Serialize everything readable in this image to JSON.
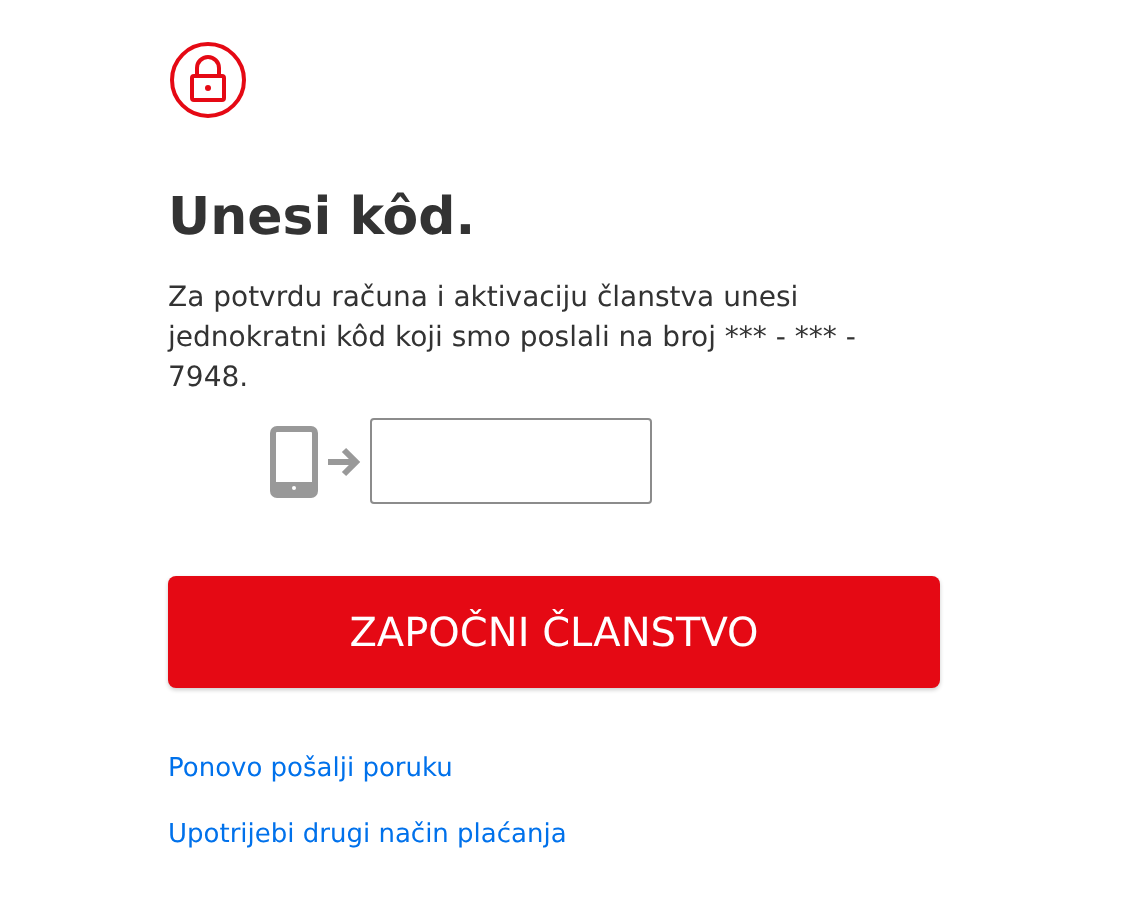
{
  "heading": "Unesi kôd.",
  "description": "Za potvrdu računa i aktivaciju članstva unesi jednokratni kôd koji smo poslali na broj *** - *** - 7948.",
  "submit_button": "ZAPOČNI ČLANSTVO",
  "links": [
    "Ponovo pošalji poruku",
    "Upotrijebi drugi način plaćanja"
  ]
}
